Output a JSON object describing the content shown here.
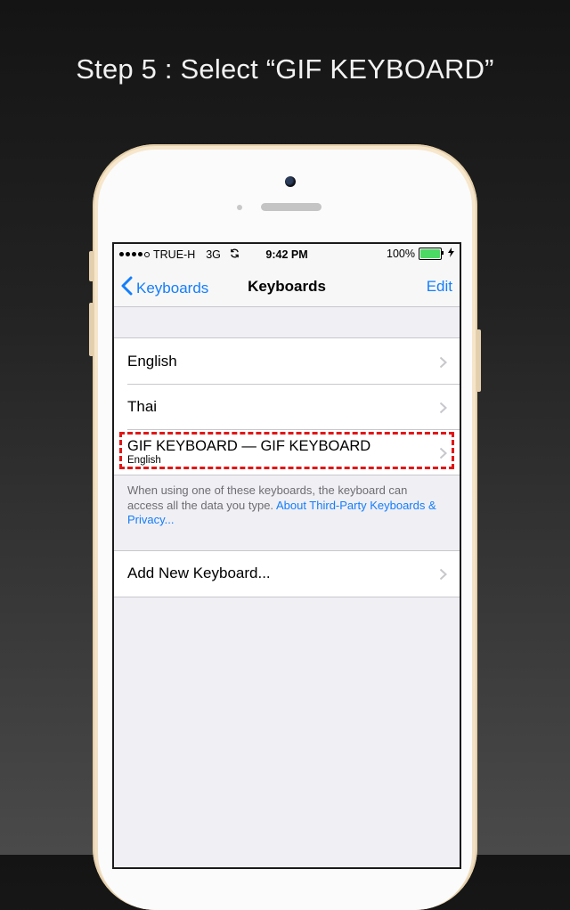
{
  "heading": "Step 5 : Select “GIF KEYBOARD”",
  "status_bar": {
    "carrier": "TRUE-H",
    "network": "3G",
    "time": "9:42 PM",
    "battery": "100%",
    "signal_bars": 4
  },
  "nav": {
    "back_label": "Keyboards",
    "title": "Keyboards",
    "edit_label": "Edit"
  },
  "keyboards": [
    {
      "name": "English"
    },
    {
      "name": "Thai"
    },
    {
      "name": "GIF KEYBOARD — GIF KEYBOARD",
      "subtitle": "English",
      "highlighted": true
    }
  ],
  "footer": {
    "text": "When using one of these keyboards, the keyboard can access all the data you type.",
    "link": "About Third-Party Keyboards & Privacy..."
  },
  "add_keyboard_label": "Add New Keyboard...",
  "colors": {
    "accent": "#147efb",
    "highlight": "#e01616",
    "battery": "#4cd964",
    "phone_frame": "#f5e4c8"
  },
  "icons": [
    "chevron-left-icon",
    "chevron-right-icon",
    "sync-icon",
    "charging-icon",
    "battery-icon"
  ]
}
